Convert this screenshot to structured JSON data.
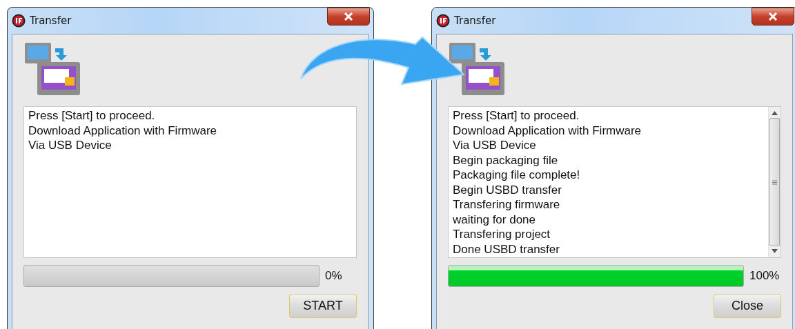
{
  "windows": [
    {
      "title": "Transfer",
      "log": [
        "Press [Start] to proceed.",
        "Download Application with Firmware",
        "Via USB Device"
      ],
      "scrollbar": false,
      "progress": {
        "level": 0,
        "reading": "0%"
      },
      "button": "START"
    },
    {
      "title": "Transfer",
      "log": [
        "Press [Start] to proceed.",
        "Download Application with Firmware",
        "Via USB Device",
        "Begin packaging file",
        "Packaging file complete!",
        "Begin USBD transfer",
        "Transfering firmware",
        "waiting for done",
        "Transfering project",
        "Done USBD transfer"
      ],
      "scrollbar": true,
      "progress": {
        "level": 1,
        "reading": "100%"
      },
      "button": "Close"
    }
  ]
}
